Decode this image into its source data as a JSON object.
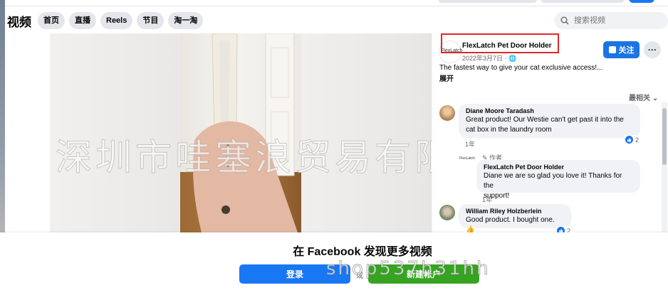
{
  "header": {
    "title": "视频",
    "tabs": [
      {
        "label": "首页"
      },
      {
        "label": "直播"
      },
      {
        "label": "Reels"
      },
      {
        "label": "节目"
      },
      {
        "label": "淘一淘"
      }
    ],
    "search_placeholder": "搜索视频"
  },
  "watermark": "深圳市哇塞浪贸易有限公司",
  "watermark_secondary": "shop537h31hh",
  "post": {
    "page_name": "FlexLatch Pet Door Holder",
    "logo_text": "FlexLatch",
    "date": "2022年3月7日 · ",
    "follow_label": "关注",
    "more_label": "···",
    "description": "The fastest way to give your cat exclusive access!...",
    "expand_label": "展开",
    "sort_label": "最相关"
  },
  "comments": [
    {
      "author": "Diane Moore Taradash",
      "text_lines": [
        "Great product! Our Westie can't get past it into the",
        "cat box in the laundry room"
      ],
      "time": "1年",
      "reactions": "2"
    },
    {
      "author_badge": "作者",
      "author": "FlexLatch Pet Door Holder",
      "avatar_text": "FlexLatch",
      "text_lines": [
        "Diane we are so glad you love it! Thanks for the",
        "support!"
      ],
      "time": "1年"
    },
    {
      "author": "William Riley Holzberlein",
      "text_lines": [
        "Good product. I bought one."
      ],
      "reactions": "2"
    }
  ],
  "footer": {
    "promo": "在 Facebook 发现更多视频",
    "login_label": "登录",
    "or_label": "或",
    "signup_label": "新建帐户"
  },
  "colors": {
    "primary_blue": "#1877f2",
    "follow_blue": "#1b74e4",
    "signup_green": "#36a420",
    "highlight_red": "#e02828"
  }
}
